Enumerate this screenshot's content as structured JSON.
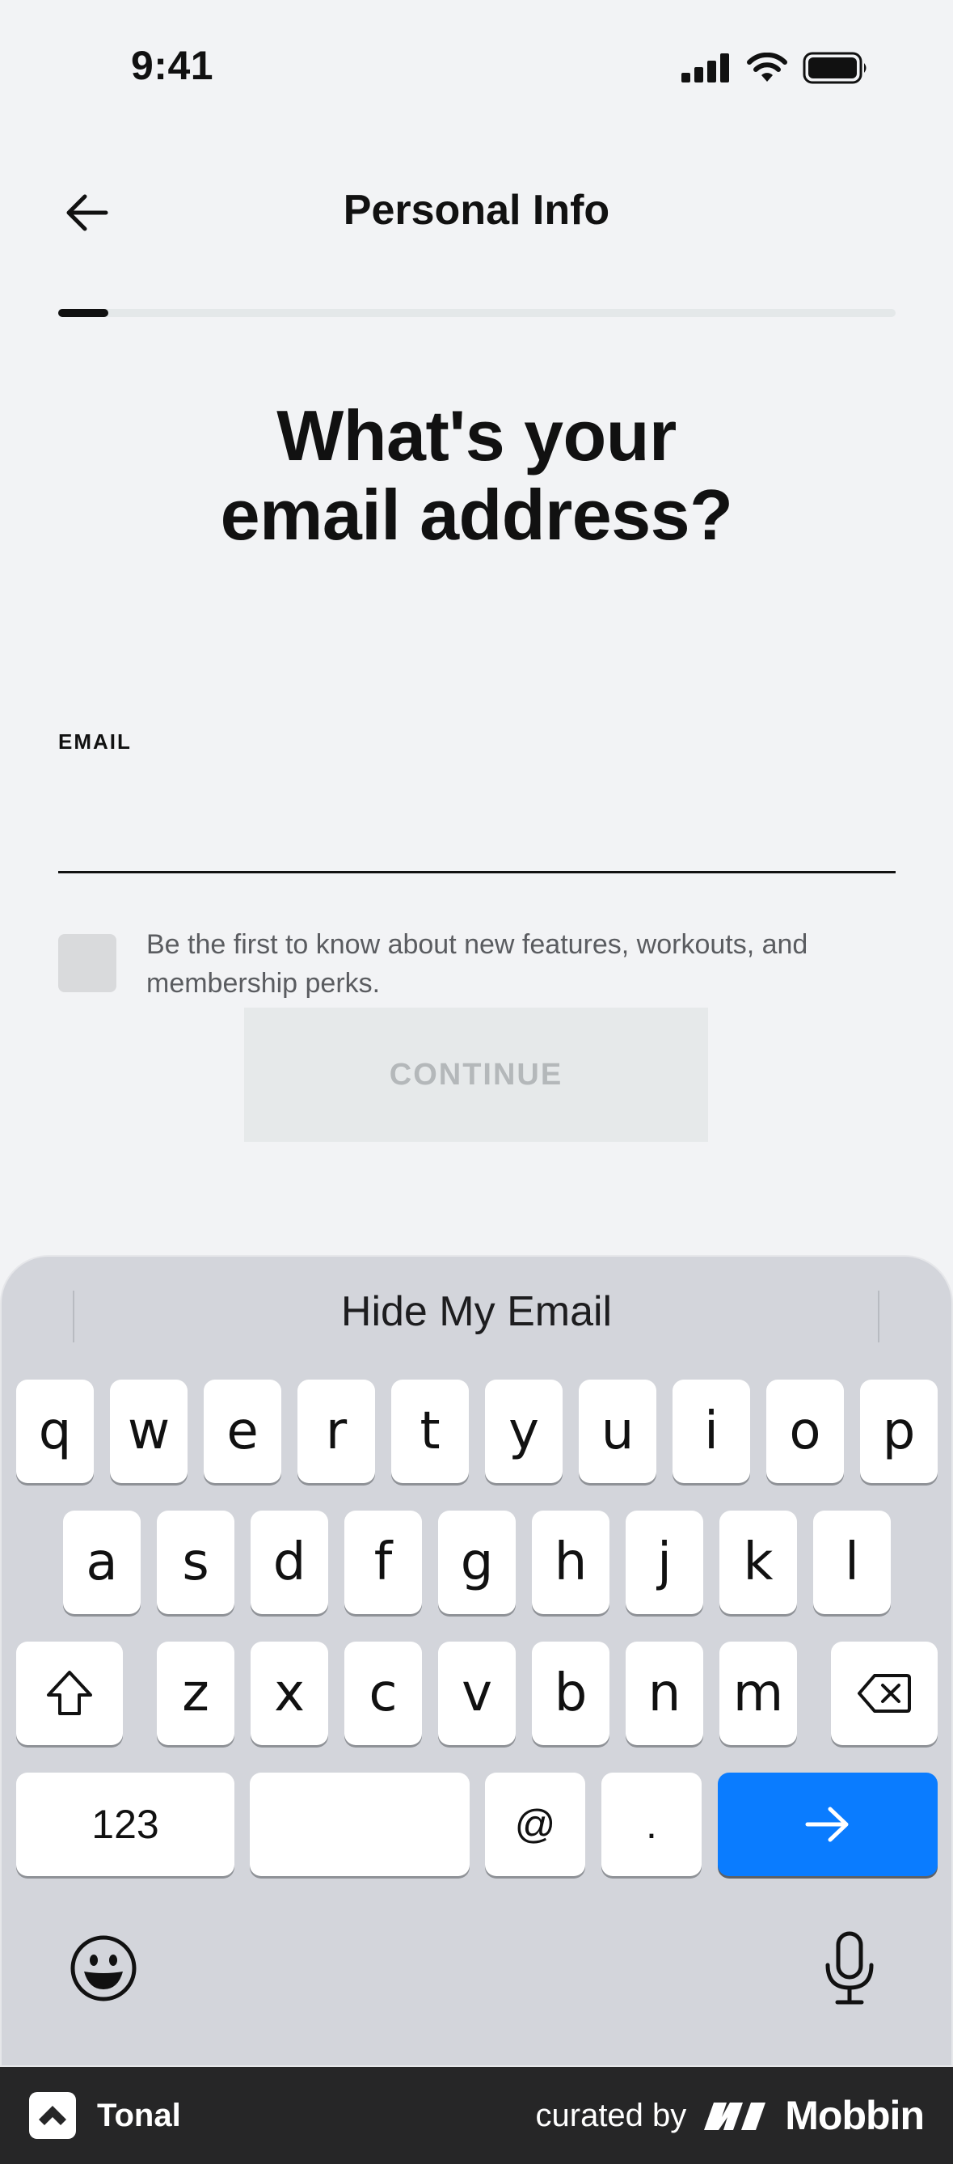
{
  "status_bar": {
    "time": "9:41"
  },
  "header": {
    "title": "Personal Info",
    "back_icon": "arrow-left-icon"
  },
  "progress": {
    "value": 0.06
  },
  "question": {
    "line1": "What's your",
    "line2": "email address?"
  },
  "email_field": {
    "label": "EMAIL",
    "value": "",
    "placeholder": ""
  },
  "opt_in": {
    "text": "Be the first to know about new features, workouts, and membership perks.",
    "checked": false
  },
  "continue_button": {
    "label": "CONTINUE"
  },
  "keyboard": {
    "suggestion": "Hide My Email",
    "row1": [
      "q",
      "w",
      "e",
      "r",
      "t",
      "y",
      "u",
      "i",
      "o",
      "p"
    ],
    "row2": [
      "a",
      "s",
      "d",
      "f",
      "g",
      "h",
      "j",
      "k",
      "l"
    ],
    "row3": [
      "z",
      "x",
      "c",
      "v",
      "b",
      "n",
      "m"
    ],
    "numbers_label": "123",
    "at_label": "@",
    "dot_label": ".",
    "go_color": "#0a7cff"
  },
  "footer": {
    "app_name": "Tonal",
    "curated_by": "curated by",
    "brand": "Mobbin"
  }
}
